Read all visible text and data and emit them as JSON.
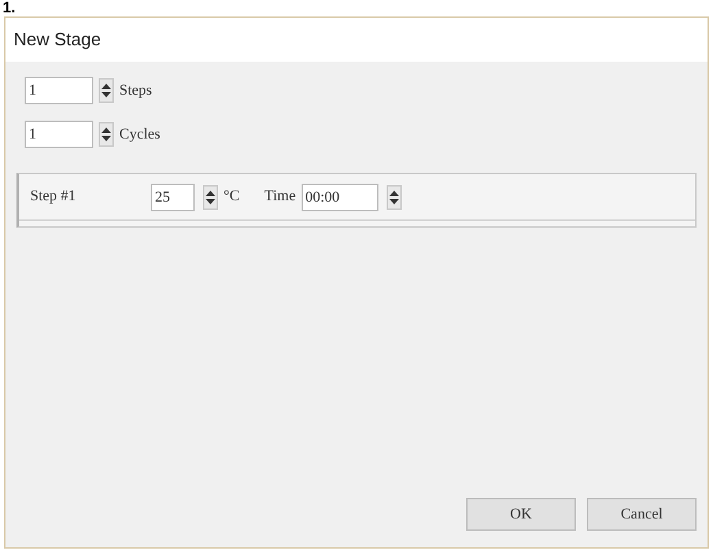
{
  "figure_label": "1.",
  "window": {
    "title": "New Stage"
  },
  "counters": [
    {
      "value": "1",
      "label": "Steps"
    },
    {
      "value": "1",
      "label": "Cycles"
    }
  ],
  "steps": [
    {
      "label": "Step #1",
      "temperature": "25",
      "unit": "°C",
      "time_label": "Time",
      "time": "00:00"
    }
  ],
  "buttons": [
    "OK",
    "Cancel"
  ]
}
